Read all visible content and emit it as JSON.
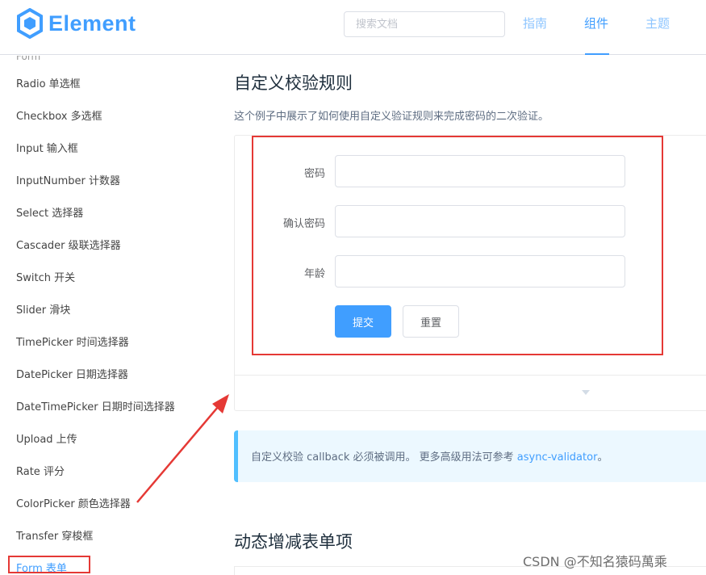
{
  "header": {
    "logo_text": "Element",
    "search_placeholder": "搜索文档",
    "nav": [
      "指南",
      "组件",
      "主题"
    ],
    "active_nav": "组件"
  },
  "sidebar": {
    "group_label": "Form",
    "items": [
      "Radio 单选框",
      "Checkbox 多选框",
      "Input 输入框",
      "InputNumber 计数器",
      "Select 选择器",
      "Cascader 级联选择器",
      "Switch 开关",
      "Slider 滑块",
      "TimePicker 时间选择器",
      "DatePicker 日期选择器",
      "DateTimePicker 日期时间选择器",
      "Upload 上传",
      "Rate 评分",
      "ColorPicker 颜色选择器",
      "Transfer 穿梭框",
      "Form 表单"
    ],
    "active_item": "Form 表单"
  },
  "main": {
    "section_title": "自定义校验规则",
    "description": "这个例子中展示了如何使用自定义验证规则来完成密码的二次验证。",
    "form": {
      "fields": [
        {
          "label": "密码",
          "value": ""
        },
        {
          "label": "确认密码",
          "value": ""
        },
        {
          "label": "年龄",
          "value": ""
        }
      ],
      "submit_label": "提交",
      "reset_label": "重置"
    },
    "tip": {
      "text_before": "自定义校验 callback 必须被调用。 更多高级用法可参考 ",
      "link": "async-validator",
      "text_after": "。"
    },
    "next_section_title": "动态增减表单项"
  },
  "watermark": "CSDN @不知名猿码萬乘",
  "colors": {
    "accent": "#409eff",
    "annotation": "#e53935",
    "tip_bg": "#ecf8ff",
    "tip_border": "#50bfff"
  }
}
